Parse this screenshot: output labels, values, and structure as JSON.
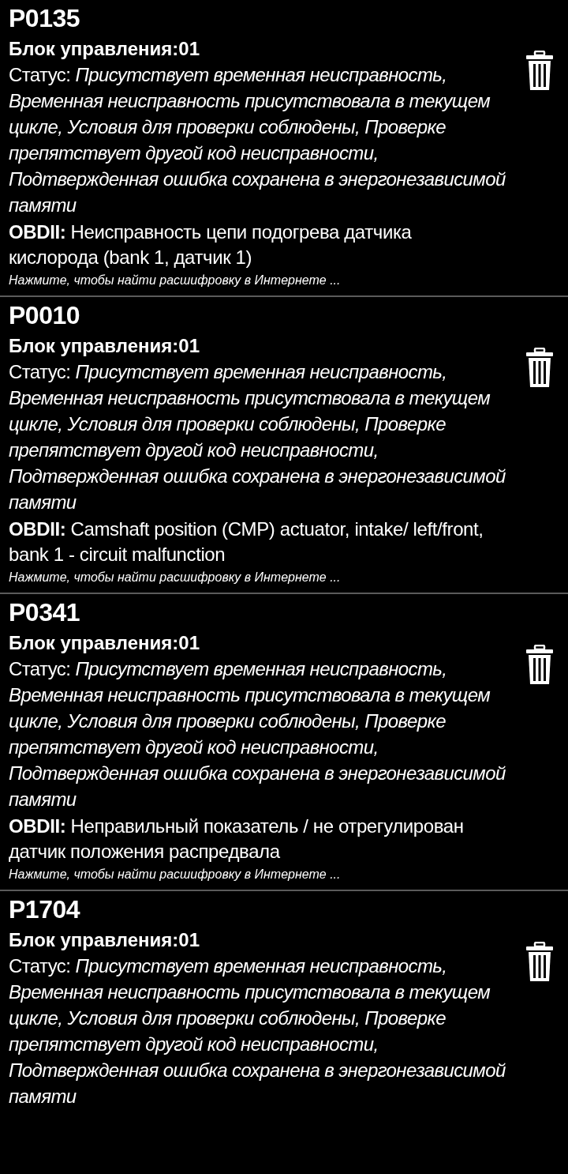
{
  "codes": [
    {
      "code": "P0135",
      "unit": "Блок управления:01",
      "status": "Статус: *Присутствует временная неисправность, Временная неисправность присутствовала в текущем цикле, Условия для проверки соблюдены, Проверке препятствует другой код неисправности, Подтвержденная ошибка сохранена в энергонезависимой памяти*",
      "description": "**OBDII:** Неисправность цепи подогрева датчика кислорода (bank 1, датчик 1)",
      "link": "Нажмите, чтобы найти расшифровку в Интернете ..."
    },
    {
      "code": "P0010",
      "unit": "Блок управления:01",
      "status": "Статус: *Присутствует временная неисправность, Временная неисправность присутствовала в текущем цикле, Условия для проверки соблюдены, Проверке препятствует другой код неисправности, Подтвержденная ошибка сохранена в энергонезависимой памяти*",
      "description": "**OBDII:** Camshaft position (CMP) actuator, intake/ left/front, bank 1 - circuit malfunction",
      "link": "Нажмите, чтобы найти расшифровку в Интернете ..."
    },
    {
      "code": "P0341",
      "unit": "Блок управления:01",
      "status": "Статус: *Присутствует временная неисправность, Временная неисправность присутствовала в текущем цикле, Условия для проверки соблюдены, Проверке препятствует другой код неисправности, Подтвержденная ошибка сохранена в энергонезависимой памяти*",
      "description": "**OBDII:** Неправильный показатель / не отрегулирован датчик положения распредвала",
      "link": "Нажмите, чтобы найти расшифровку в Интернете ..."
    },
    {
      "code": "P1704",
      "unit": "Блок управления:01",
      "status": "Статус: *Присутствует временная неисправность, Временная неисправность присутствовала в текущем цикле, Условия для проверки соблюдены, Проверке препятствует другой код неисправности, Подтвержденная ошибка сохранена в энергонезависимой памяти*"
    }
  ]
}
